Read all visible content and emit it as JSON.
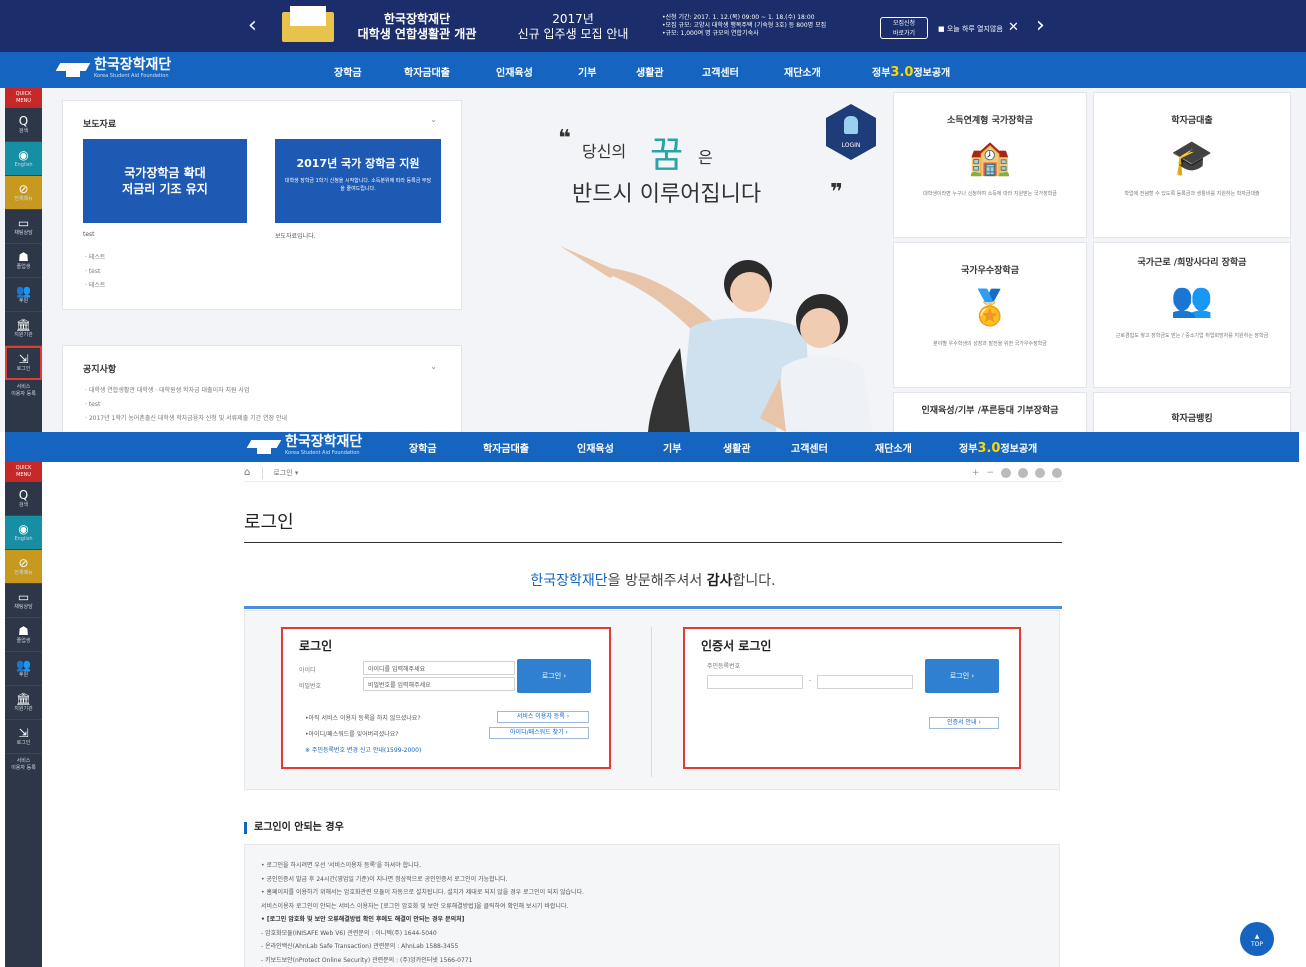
{
  "promo": {
    "title_line1": "한국장학재단",
    "title_line2": "대학생 연합생활관 개관",
    "sub_line1": "2017년",
    "sub_line2": "신규 입주생 모집 안내",
    "detail_line1": "•신청 기간: 2017. 1. 12.(목) 09:00 ~ 1. 18.(수) 18:00",
    "detail_line2": "•모집 규모: 고양시 대학생 행복주택 (기숙형 3호) 등 800명 모집",
    "detail_line3": "•규모: 1,000여 명 규모의 연합기숙사",
    "apply_line1": "모집신청",
    "apply_line2": "바로가기",
    "hide_today": "■ 오늘 하루 열지않음",
    "close": "✕",
    "prev": "‹",
    "next": "›"
  },
  "logo": {
    "name": "한국장학재단",
    "sub": "Korea Student Aid Foundation"
  },
  "menu": [
    "장학금",
    "학자금대출",
    "인재육성",
    "기부",
    "생활관",
    "고객센터",
    "재단소개"
  ],
  "gov30": {
    "pre": "정부",
    "num": "3.0",
    "post": "정보공개"
  },
  "quick_menu": {
    "title_line1": "QUICK",
    "title_line2": "MENU",
    "items": [
      {
        "icon": "Q",
        "label": "검색"
      },
      {
        "icon": "◉",
        "label": "English"
      },
      {
        "icon": "⊘",
        "label": "전체메뉴"
      },
      {
        "icon": "▭",
        "label": "채팅상담"
      },
      {
        "icon": "☗",
        "label": "졸업생"
      },
      {
        "icon": "👥",
        "label": "후원"
      },
      {
        "icon": "🏛",
        "label": "지원기관"
      },
      {
        "icon": "⇲",
        "label": "로그인"
      }
    ],
    "last_line1": "서비스",
    "last_line2": "이용자 등록"
  },
  "press": {
    "heading": "보도자료",
    "banner1_line1": "국가장학금 확대",
    "banner1_line2": "저금리 기조 유지",
    "banner2_title": "2017년 국가 장학금 지원",
    "banner2_body": "대학생 장학금 1학기 신청을 시작합니다. 소득분위에 따라 등록금 부담을 줄여드립니다.",
    "caption1": "test",
    "caption2": "보도자료입니다.",
    "items": [
      "· 테스트",
      "· test",
      "· 테스트"
    ]
  },
  "notice": {
    "heading": "공지사항",
    "items": [
      "· 대학생 연합생활관 대학생 · 대학원생 학자금 대출이자 지원 사업",
      "· test",
      "· 2017년 1학기 농어촌출신 대학생 학자금융자 신청 및 서류제출 기간 연장 안내"
    ]
  },
  "hero": {
    "quote_open": "❝",
    "line1": "당신의",
    "dream": "꿈",
    "particle": "은",
    "line2": "반드시 이루어집니다",
    "quote_close": "❞",
    "badge": "LOGIN"
  },
  "tiles": [
    {
      "title": "소득연계형 국가장학금",
      "icon": "🏫",
      "desc": "대학생이라면 누구나 신청하여 소득에 따라 지원받는 국가장학금"
    },
    {
      "title": "학자금대출",
      "icon": "🎓",
      "desc": "학업에 전념할 수 있도록 등록금과 생활비를 지원하는 학자금대출"
    },
    {
      "title": "국가우수장학금",
      "icon": "🏅",
      "desc": "분야별 우수학생의 성장과 발전을 위한 국가우수장학금"
    },
    {
      "title": "국가근로 /희망사다리 장학금",
      "icon": "👥",
      "desc": "근로경험도 쌓고 장학금도 받는 / 중소기업 취업희망자를 지원하는 장학금"
    },
    {
      "title": "인재육성/기부 /푸른등대 기부장학금",
      "icon": "",
      "desc": ""
    },
    {
      "title": "학자금뱅킹",
      "icon": "",
      "desc": ""
    }
  ],
  "breadcrumb": {
    "home": "⌂",
    "current": "로그인 ▾",
    "tools": [
      "+",
      "−"
    ]
  },
  "page": {
    "title": "로그인",
    "welcome_org": "한국장학재단",
    "welcome_mid": "을 방문해주셔서 ",
    "welcome_strong": "감사",
    "welcome_end": "합니다."
  },
  "login": {
    "heading": "로그인",
    "id_label": "아이디",
    "id_placeholder": "아이디를 입력해주세요",
    "pw_label": "비밀번호",
    "pw_placeholder": "비밀번호를 입력해주세요",
    "button": "로그인  ›",
    "q1": "•아직 서비스 이용자 등록을 하지 않으셨나요?",
    "q1_btn": "서비스 이용자 등록 ›",
    "q2": "•아이디/패스워드를 잊어버리셨나요?",
    "q2_btn": "아이디/패스워드 찾기 ›",
    "notice_link": "※ 주민등록번호 변경 신고 안내(1599-2000)"
  },
  "cert_login": {
    "heading": "인증서 로그인",
    "rrn_label": "주민등록번호",
    "dash": "-",
    "button": "로그인  ›",
    "guide_btn": "인증서 안내 ›"
  },
  "trouble": {
    "heading": "로그인이 안되는 경우",
    "items": [
      "• 로그인을 하시려면 우선 '서비스이용자 등록'을 하셔야 합니다.",
      "• 공인인증서 발급 후 24시간(영업일 기준)이 지나면 정상적으로 공인인증서 로그인이 가능합니다.",
      "• 홈페이지를 이용하기 위해서는 암호화관련 모듈이 자동으로 설치됩니다. 설치가 제대로 되지 않을 경우 로그인이 되지 않습니다.",
      "  서비스이용자 로그인이 안되는 서비스 이용자는 [로그인 암호화 및 보안 오류해결방법]을 클릭하여 확인해 보시기 바랍니다.",
      "• [로그인 암호화 및 보안 오류해결방법 확인 후에도 해결이 안되는 경우 문의처]",
      "  - 암호화모듈(INISAFE Web V6) 관련문의 : 이니텍(주) 1644-5040",
      "  - 온라인백신(AhnLab Safe Transaction) 관련문의 : AhnLab 1588-3455",
      "  - 키보드보안(nProtect Online Security) 관련문의 : (주)잉카인터넷 1566-0771"
    ]
  },
  "top_button": "TOP"
}
